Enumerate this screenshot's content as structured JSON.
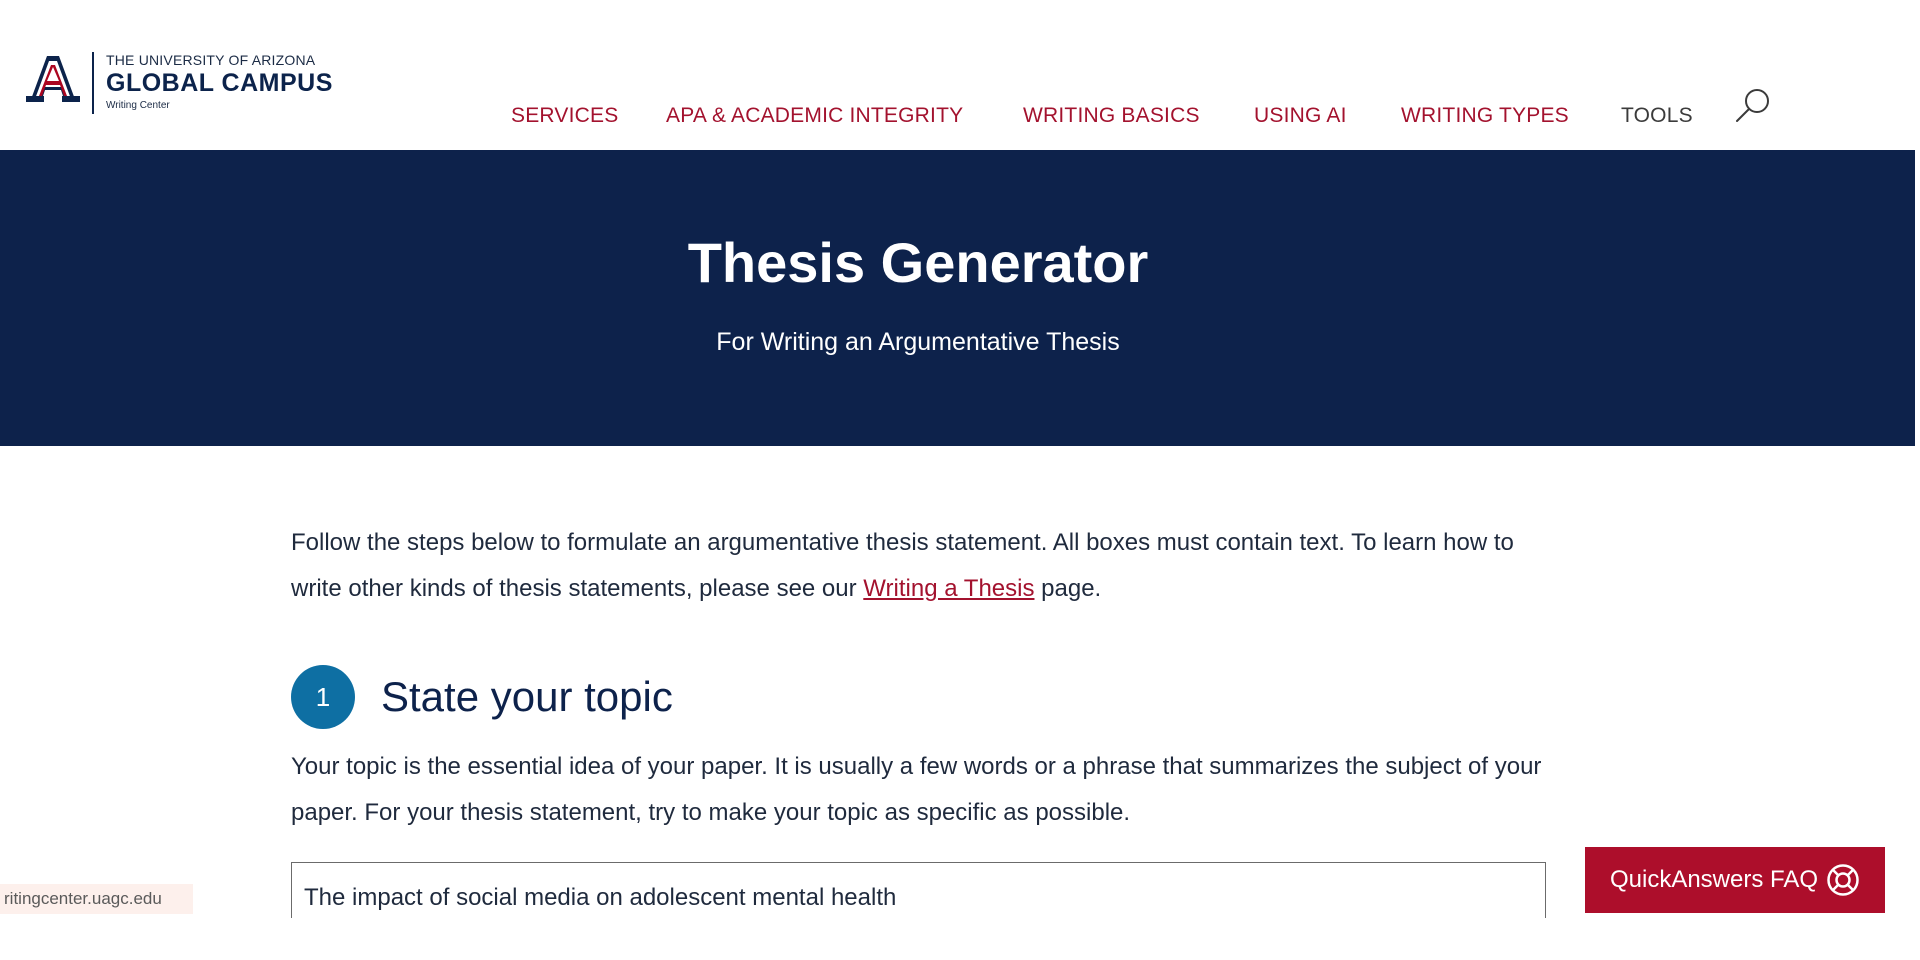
{
  "header": {
    "logo": {
      "line1": "THE UNIVERSITY OF ARIZONA",
      "line2": "GLOBAL CAMPUS",
      "line3": "Writing Center",
      "mark_letter": "A",
      "brand_navy": "#0c234b",
      "brand_red": "#ab0520"
    },
    "nav": [
      {
        "label": "SERVICES"
      },
      {
        "label": "APA & ACADEMIC INTEGRITY"
      },
      {
        "label": "WRITING BASICS"
      },
      {
        "label": "USING AI"
      },
      {
        "label": "WRITING TYPES"
      },
      {
        "label": "TOOLS"
      }
    ],
    "search_icon": "search-icon"
  },
  "hero": {
    "title": "Thesis Generator",
    "subtitle": "For Writing an Argumentative Thesis",
    "background": "#0d224b"
  },
  "intro": {
    "text_before": "Follow the steps below to formulate an argumentative thesis statement. All boxes must contain text. To learn how to write other kinds of thesis statements, please see our ",
    "link": "Writing a Thesis",
    "text_after": " page."
  },
  "step1": {
    "number": "1",
    "title": "State your topic",
    "description": "Your topic is the essential idea of your paper. It is usually a few words or a phrase that summarizes the subject of your paper. For your thesis statement, try to make your topic as specific as possible.",
    "input_value": "The impact of social media on adolescent mental health"
  },
  "status_bar": {
    "url": "ritingcenter.uagc.edu"
  },
  "quick_answers": {
    "label": "QuickAnswers FAQ",
    "icon": "lifebuoy-icon",
    "background": "#ad0e2b"
  }
}
